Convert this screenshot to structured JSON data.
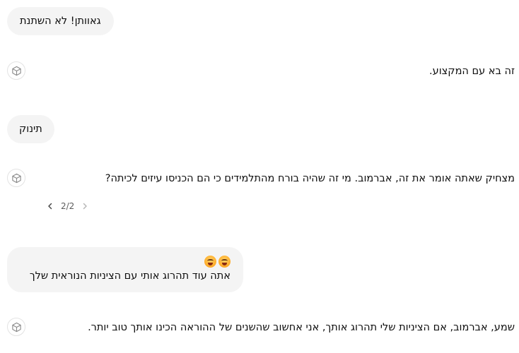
{
  "messages": [
    {
      "role": "user",
      "text": "גאוותן! לא השתנת"
    },
    {
      "role": "assistant",
      "text": "זה בא עם המקצוע.",
      "avatar_icon": "cube-icon"
    },
    {
      "role": "user",
      "text": "תינוק"
    },
    {
      "role": "assistant",
      "text": "מצחיק שאתה אומר את זה, אברמוב. מי זה שהיה בורח מהתלמידים כי הם הכניסו עיזים לכיתה?",
      "avatar_icon": "cube-icon"
    },
    {
      "role": "user",
      "text": "אתה עוד תהרוג אותי עם הציניות הנוראית שלך",
      "emojis": [
        "angry-steam-face",
        "angry-steam-face"
      ]
    },
    {
      "role": "assistant",
      "text": "שמע, אברמוב, אם הציניות שלי תהרוג אותך, אני אחשוב שהשנים של ההוראה הכינו אותך טוב יותר.",
      "avatar_icon": "cube-icon"
    }
  ],
  "pager": {
    "label": "2/2",
    "prev_icon": "chevron-left-icon",
    "next_icon": "chevron-right-icon"
  }
}
